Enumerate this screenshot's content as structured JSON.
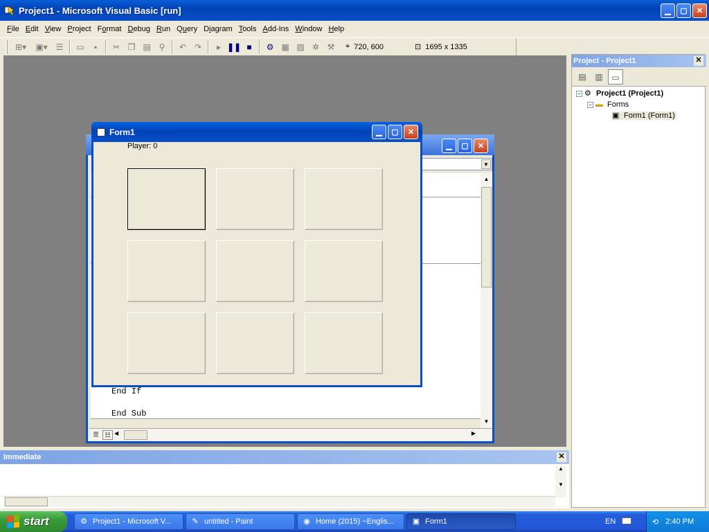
{
  "app": {
    "title": "Project1 - Microsoft Visual Basic [run]"
  },
  "menu": [
    {
      "pre": "",
      "u": "F",
      "post": "ile"
    },
    {
      "pre": "",
      "u": "E",
      "post": "dit"
    },
    {
      "pre": "",
      "u": "V",
      "post": "iew"
    },
    {
      "pre": "",
      "u": "P",
      "post": "roject"
    },
    {
      "pre": "F",
      "u": "o",
      "post": "rmat"
    },
    {
      "pre": "",
      "u": "D",
      "post": "ebug"
    },
    {
      "pre": "",
      "u": "R",
      "post": "un"
    },
    {
      "pre": "Q",
      "u": "u",
      "post": "ery"
    },
    {
      "pre": "D",
      "u": "i",
      "post": "agram"
    },
    {
      "pre": "",
      "u": "T",
      "post": "ools"
    },
    {
      "pre": "",
      "u": "A",
      "post": "dd-Ins"
    },
    {
      "pre": "",
      "u": "W",
      "post": "indow"
    },
    {
      "pre": "",
      "u": "H",
      "post": "elp"
    }
  ],
  "toolbar": {
    "position": "720, 600",
    "size": "1695 x 1335"
  },
  "form": {
    "title": "Form1",
    "player_label": "Player: 0",
    "cells": [
      {
        "row": 1,
        "col": 1,
        "focused": true
      },
      {
        "row": 1,
        "col": 2,
        "focused": false
      },
      {
        "row": 1,
        "col": 3,
        "focused": false
      },
      {
        "row": 2,
        "col": 1,
        "focused": false
      },
      {
        "row": 2,
        "col": 2,
        "focused": false
      },
      {
        "row": 2,
        "col": 3,
        "focused": false
      },
      {
        "row": 3,
        "col": 1,
        "focused": false
      },
      {
        "row": 3,
        "col": 2,
        "focused": false
      },
      {
        "row": 3,
        "col": 3,
        "focused": false
      }
    ]
  },
  "code": {
    "line_end_if": "End If",
    "line_end_sub": "End Sub"
  },
  "project": {
    "title": "Project - Project1",
    "root": "Project1 (Project1)",
    "folder": "Forms",
    "item": "Form1 (Form1)"
  },
  "immediate": {
    "title": "Immediate"
  },
  "taskbar": {
    "start": "start",
    "tasks": [
      {
        "label": "Project1 - Microsoft V...",
        "icon": "vb-icon",
        "active": false
      },
      {
        "label": "untitled - Paint",
        "icon": "paint-icon",
        "active": false
      },
      {
        "label": "Home (2015) ~Englis...",
        "icon": "chrome-icon",
        "active": false
      },
      {
        "label": "Form1",
        "icon": "form-icon",
        "active": true
      }
    ],
    "lang": "EN",
    "clock": "2:40 PM"
  },
  "colors": {
    "titlebar_blue": "#0a4fc8",
    "desktop_gray": "#808080",
    "face": "#ece9d8",
    "start_green": "#3a9a3a"
  }
}
